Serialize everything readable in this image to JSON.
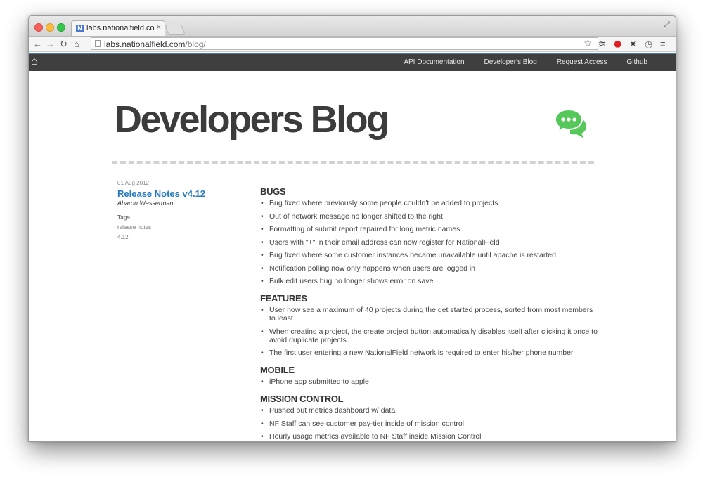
{
  "browser": {
    "tab_title": "labs.nationalfield.com/blog/",
    "tab_close": "×",
    "url_host": "labs.nationalfield.com",
    "url_path": "/blog/"
  },
  "site_nav": {
    "links": [
      "API Documentation",
      "Developer's Blog",
      "Request Access",
      "Github"
    ]
  },
  "page": {
    "title": "Developers Blog",
    "accent_color": "#56c85a"
  },
  "post": {
    "date": "01 Aug 2012",
    "title": "Release Notes v4.12",
    "author": "Aharon Wasserman",
    "tags_label": "Tags:",
    "tags": [
      "release notes",
      "4.12"
    ],
    "sections": [
      {
        "heading": "BUGS",
        "items": [
          "Bug fixed where previously some people couldn't be added to projects",
          "Out of network message no longer shifted to the right",
          "Formatting of submit report repaired for long metric names",
          "Users with \"+\" in their email address can now register for NationalField",
          "Bug fixed where some customer instances became unavailable until apache is restarted",
          "Notification polling now only happens when users are logged in",
          "Bulk edit users bug no longer shows error on save"
        ]
      },
      {
        "heading": "FEATURES",
        "items": [
          "User now see a maximum of 40 projects during the get started process, sorted from most members to least",
          "When creating a project, the create project button automatically disables itself after clicking it once to avoid duplicate projects",
          "The first user entering a new NationalField network is required to enter his/her phone number"
        ]
      },
      {
        "heading": "MOBILE",
        "items": [
          "iPhone app submitted to apple"
        ]
      },
      {
        "heading": "MISSION CONTROL",
        "items": [
          "Pushed out metrics dashboard w/ data",
          "NF Staff can see customer pay-tier inside of mission control",
          "Hourly usage metrics available to NF Staff inside Mission Control"
        ]
      }
    ]
  }
}
